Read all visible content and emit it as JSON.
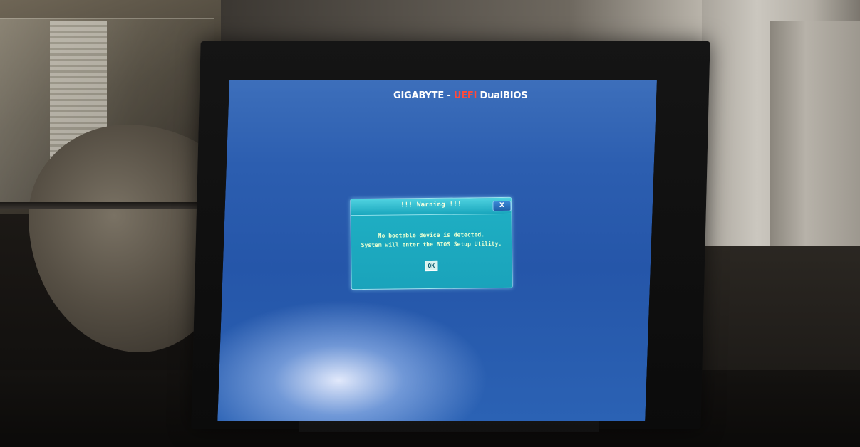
{
  "bios": {
    "brand": "GIGABYTE -",
    "uefi": "UEFI",
    "dual": "DualBIOS"
  },
  "dialog": {
    "title": "!!! Warning !!!",
    "close_label": "X",
    "message_line1": "No bootable device is detected.",
    "message_line2": "System will enter the BIOS Setup Utility.",
    "ok_label": "OK"
  },
  "colors": {
    "screen_blue": "#2556a9",
    "dialog_cyan": "#1aa3bb",
    "uefi_red": "#ff4a3a"
  }
}
